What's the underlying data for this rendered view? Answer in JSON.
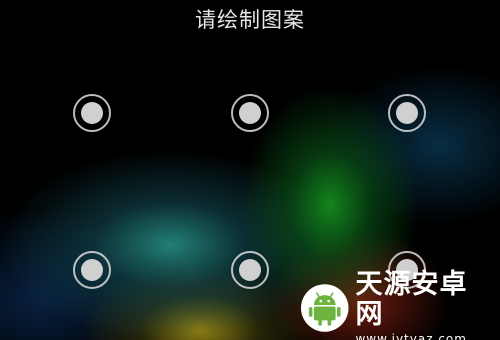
{
  "lock_screen": {
    "prompt": "请绘制图案",
    "pattern_grid": {
      "visible_dots": 6,
      "dot_color": "#d0d0d0",
      "ring_color": "#dcdcdc"
    }
  },
  "watermark": {
    "logo_icon": "android-robot-icon",
    "logo_color": "#6db33f",
    "site_name": "天源安卓网",
    "site_url": "www.jytyaz.com"
  }
}
